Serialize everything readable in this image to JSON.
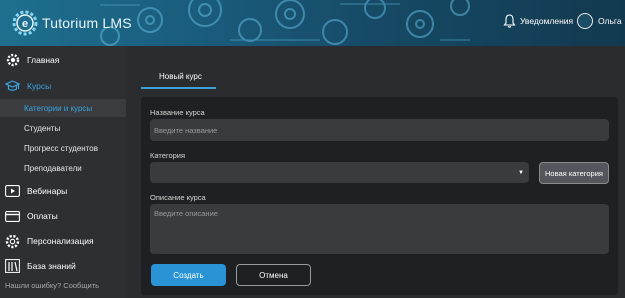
{
  "header": {
    "logo_text": "Tutorium LMS",
    "notifications_label": "Уведомления",
    "user_name": "Ольга"
  },
  "sidebar": {
    "items": [
      {
        "label": "Главная",
        "icon": "gear-icon"
      },
      {
        "label": "Курсы",
        "icon": "graduation-cap-icon"
      },
      {
        "label": "Вебинары",
        "icon": "play-icon"
      },
      {
        "label": "Оплаты",
        "icon": "credit-card-icon"
      },
      {
        "label": "Персонализация",
        "icon": "gear-icon"
      },
      {
        "label": "База знаний",
        "icon": "library-icon"
      }
    ],
    "subitems": [
      {
        "label": "Категории и курсы"
      },
      {
        "label": "Студенты"
      },
      {
        "label": "Прогресс студентов"
      },
      {
        "label": "Преподаватели"
      }
    ],
    "footer_link": "Нашли ошибку? Сообщить"
  },
  "main": {
    "tab_label": "Новый курс",
    "form": {
      "course_name_label": "Название курса",
      "course_name_placeholder": "Введите название",
      "category_label": "Категория",
      "category_value": "",
      "new_category_button": "Новая категория",
      "description_label": "Описание курса",
      "description_placeholder": "Введите описание",
      "create_button": "Создать",
      "cancel_button": "Отмена"
    }
  },
  "colors": {
    "accent": "#3ba4dc",
    "primary_button": "#2a93d5",
    "sidebar_bg": "#2e2f33",
    "card_bg": "#1f2023"
  }
}
